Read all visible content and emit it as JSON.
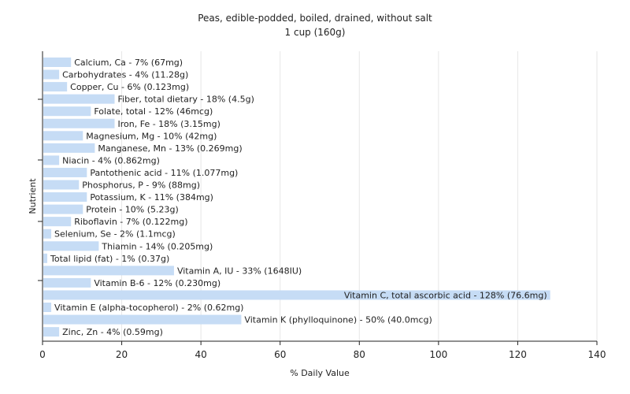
{
  "chart_data": {
    "type": "bar",
    "orientation": "horizontal",
    "title": "Peas, edible-podded, boiled, drained, without salt",
    "subtitle": "1 cup (160g)",
    "xlabel": "% Daily Value",
    "ylabel": "Nutrient",
    "xlim": [
      0,
      140
    ],
    "xticks": [
      0,
      20,
      40,
      60,
      80,
      100,
      120,
      140
    ],
    "grid": true,
    "bar_color": "#c6dcf5",
    "categories": [
      "Calcium, Ca",
      "Carbohydrates",
      "Copper, Cu",
      "Fiber, total dietary",
      "Folate, total",
      "Iron, Fe",
      "Magnesium, Mg",
      "Manganese, Mn",
      "Niacin",
      "Pantothenic acid",
      "Phosphorus, P",
      "Potassium, K",
      "Protein",
      "Riboflavin",
      "Selenium, Se",
      "Thiamin",
      "Total lipid (fat)",
      "Vitamin A, IU",
      "Vitamin B-6",
      "Vitamin C, total ascorbic acid",
      "Vitamin E (alpha-tocopherol)",
      "Vitamin K (phylloquinone)",
      "Zinc, Zn"
    ],
    "values": [
      7,
      4,
      6,
      18,
      12,
      18,
      10,
      13,
      4,
      11,
      9,
      11,
      10,
      7,
      2,
      14,
      1,
      33,
      12,
      128,
      2,
      50,
      4
    ],
    "labels": [
      "Calcium, Ca - 7% (67mg)",
      "Carbohydrates - 4% (11.28g)",
      "Copper, Cu - 6% (0.123mg)",
      "Fiber, total dietary - 18% (4.5g)",
      "Folate, total - 12% (46mcg)",
      "Iron, Fe - 18% (3.15mg)",
      "Magnesium, Mg - 10% (42mg)",
      "Manganese, Mn - 13% (0.269mg)",
      "Niacin - 4% (0.862mg)",
      "Pantothenic acid - 11% (1.077mg)",
      "Phosphorus, P - 9% (88mg)",
      "Potassium, K - 11% (384mg)",
      "Protein - 10% (5.23g)",
      "Riboflavin - 7% (0.122mg)",
      "Selenium, Se - 2% (1.1mcg)",
      "Thiamin - 14% (0.205mg)",
      "Total lipid (fat) - 1% (0.37g)",
      "Vitamin A, IU - 33% (1648IU)",
      "Vitamin B-6 - 12% (0.230mg)",
      "Vitamin C, total ascorbic acid - 128% (76.6mg)",
      "Vitamin E (alpha-tocopherol) - 2% (0.62mg)",
      "Vitamin K (phylloquinone) - 50% (40.0mcg)",
      "Zinc, Zn - 4% (0.59mg)"
    ]
  }
}
